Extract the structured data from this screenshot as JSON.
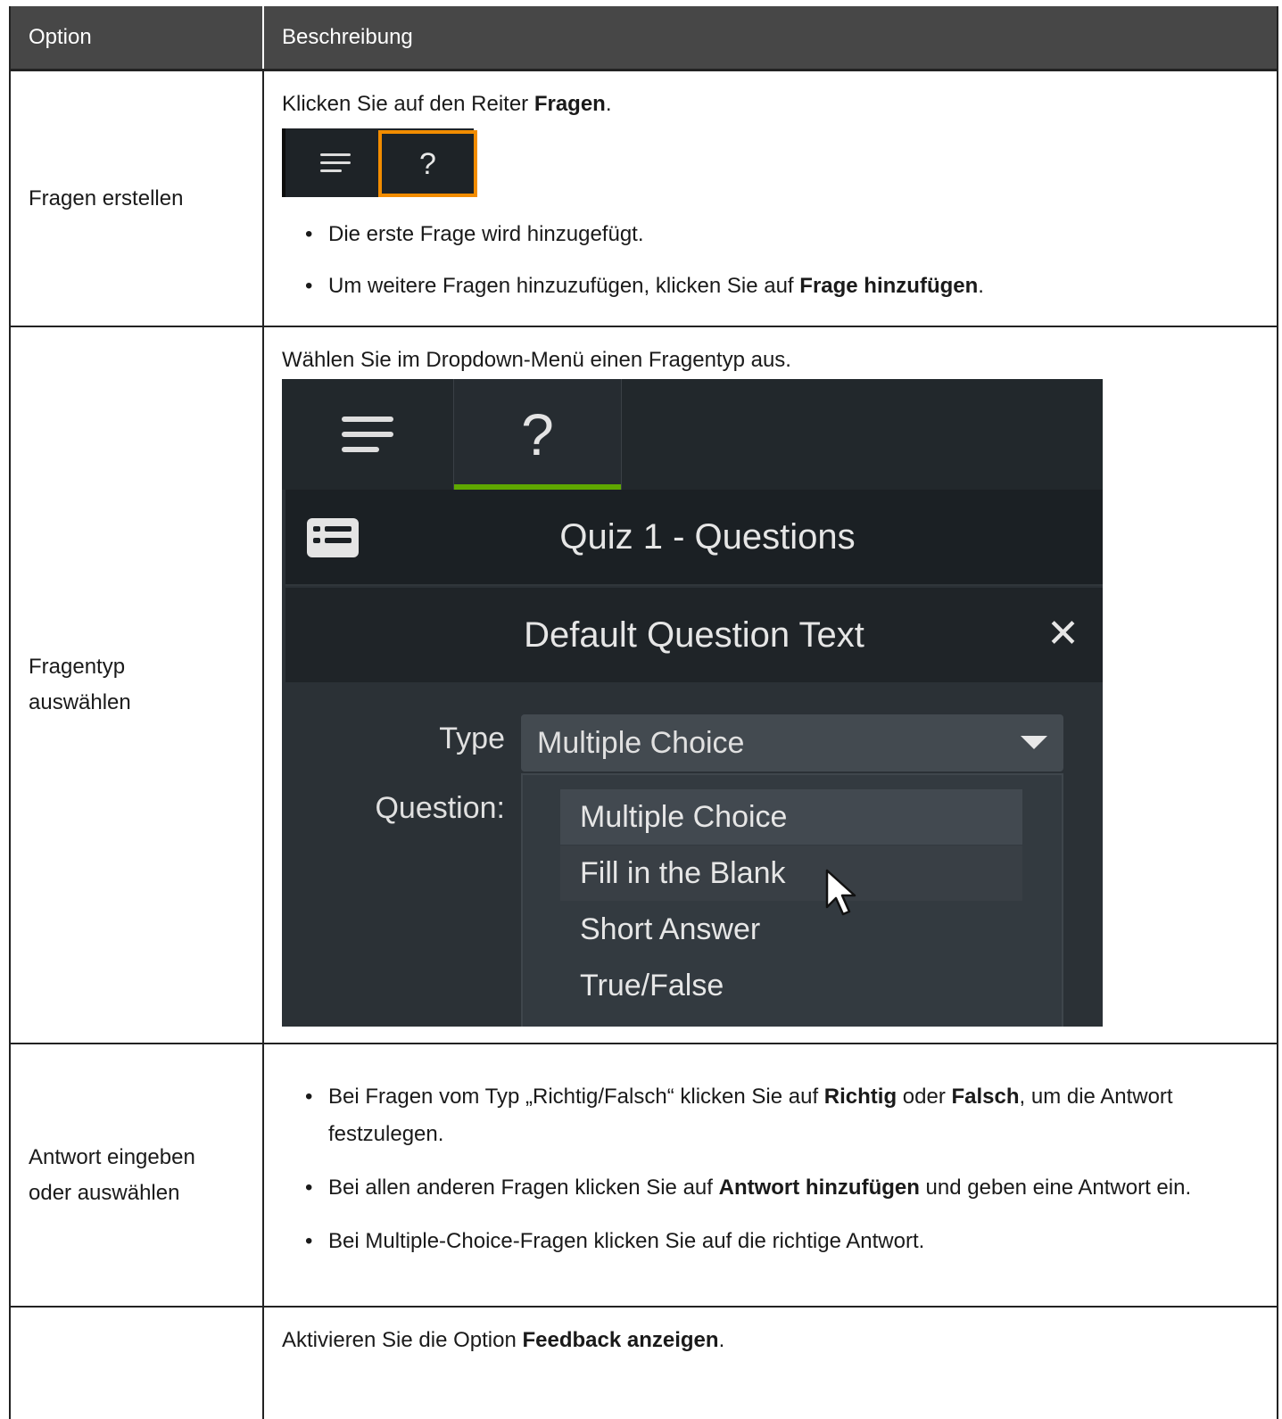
{
  "header": {
    "col1": "Option",
    "col2": "Beschreibung"
  },
  "rows": [
    {
      "option": "Fragen erstellen",
      "intro_pre": "Klicken Sie auf den Reiter ",
      "intro_bold": "Fragen",
      "intro_post": ".",
      "tab_question_glyph": "?",
      "bullets": [
        {
          "pre": "Die erste Frage wird hinzugefügt.",
          "bold": "",
          "post": ""
        },
        {
          "pre": "Um weitere Fragen hinzuzufügen, klicken Sie auf ",
          "bold": "Frage hinzufügen",
          "post": "."
        }
      ]
    },
    {
      "option": "Fragentyp auswählen",
      "intro": "Wählen Sie im Dropdown-Menü einen Fragentyp aus.",
      "screenshot": {
        "tab_question_glyph": "?",
        "quiz_title": "Quiz 1 - Questions",
        "question_text": "Default Question Text",
        "close_glyph": "✕",
        "type_label": "Type",
        "type_value": "Multiple Choice",
        "question_label": "Question:",
        "options": [
          "Multiple Choice",
          "Fill in the Blank",
          "Short Answer",
          "True/False"
        ]
      }
    },
    {
      "option": "Antwort eingeben oder auswählen",
      "bullets": [
        {
          "p1": "Bei Fragen vom Typ „Richtig/Falsch“ klicken Sie auf ",
          "b1": "Richtig",
          "p2": " oder ",
          "b2": "Falsch",
          "p3": ", um die Antwort festzulegen."
        },
        {
          "p1": "Bei allen anderen Fragen klicken Sie auf ",
          "b1": "Antwort hinzufügen",
          "p2": " und geben eine Antwort ein.",
          "b2": "",
          "p3": ""
        },
        {
          "p1": "Bei Multiple-Choice-Fragen klicken Sie auf die richtige Antwort.",
          "b1": "",
          "p2": "",
          "b2": "",
          "p3": ""
        }
      ]
    },
    {
      "option": "",
      "intro_pre": "Aktivieren Sie die Option ",
      "intro_bold": "Feedback anzeigen",
      "intro_post": "."
    }
  ],
  "colors": {
    "header_bg": "#474747",
    "highlight_orange": "#f28c00",
    "tab_underline_green": "#5fa800"
  },
  "icons": [
    "hamburger-menu-icon",
    "question-mark-icon",
    "list-icon",
    "close-icon",
    "dropdown-caret-icon",
    "mouse-cursor-icon"
  ]
}
